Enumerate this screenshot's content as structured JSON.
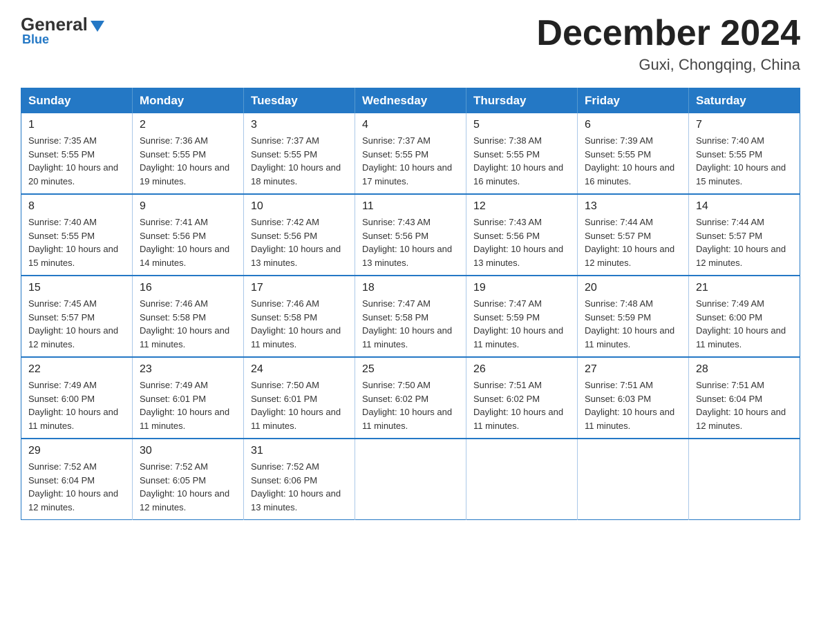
{
  "header": {
    "logo_general": "General",
    "logo_blue": "Blue",
    "month_title": "December 2024",
    "location": "Guxi, Chongqing, China"
  },
  "weekdays": [
    "Sunday",
    "Monday",
    "Tuesday",
    "Wednesday",
    "Thursday",
    "Friday",
    "Saturday"
  ],
  "weeks": [
    [
      {
        "day": "1",
        "sunrise": "7:35 AM",
        "sunset": "5:55 PM",
        "daylight": "10 hours and 20 minutes."
      },
      {
        "day": "2",
        "sunrise": "7:36 AM",
        "sunset": "5:55 PM",
        "daylight": "10 hours and 19 minutes."
      },
      {
        "day": "3",
        "sunrise": "7:37 AM",
        "sunset": "5:55 PM",
        "daylight": "10 hours and 18 minutes."
      },
      {
        "day": "4",
        "sunrise": "7:37 AM",
        "sunset": "5:55 PM",
        "daylight": "10 hours and 17 minutes."
      },
      {
        "day": "5",
        "sunrise": "7:38 AM",
        "sunset": "5:55 PM",
        "daylight": "10 hours and 16 minutes."
      },
      {
        "day": "6",
        "sunrise": "7:39 AM",
        "sunset": "5:55 PM",
        "daylight": "10 hours and 16 minutes."
      },
      {
        "day": "7",
        "sunrise": "7:40 AM",
        "sunset": "5:55 PM",
        "daylight": "10 hours and 15 minutes."
      }
    ],
    [
      {
        "day": "8",
        "sunrise": "7:40 AM",
        "sunset": "5:55 PM",
        "daylight": "10 hours and 15 minutes."
      },
      {
        "day": "9",
        "sunrise": "7:41 AM",
        "sunset": "5:56 PM",
        "daylight": "10 hours and 14 minutes."
      },
      {
        "day": "10",
        "sunrise": "7:42 AM",
        "sunset": "5:56 PM",
        "daylight": "10 hours and 13 minutes."
      },
      {
        "day": "11",
        "sunrise": "7:43 AM",
        "sunset": "5:56 PM",
        "daylight": "10 hours and 13 minutes."
      },
      {
        "day": "12",
        "sunrise": "7:43 AM",
        "sunset": "5:56 PM",
        "daylight": "10 hours and 13 minutes."
      },
      {
        "day": "13",
        "sunrise": "7:44 AM",
        "sunset": "5:57 PM",
        "daylight": "10 hours and 12 minutes."
      },
      {
        "day": "14",
        "sunrise": "7:44 AM",
        "sunset": "5:57 PM",
        "daylight": "10 hours and 12 minutes."
      }
    ],
    [
      {
        "day": "15",
        "sunrise": "7:45 AM",
        "sunset": "5:57 PM",
        "daylight": "10 hours and 12 minutes."
      },
      {
        "day": "16",
        "sunrise": "7:46 AM",
        "sunset": "5:58 PM",
        "daylight": "10 hours and 11 minutes."
      },
      {
        "day": "17",
        "sunrise": "7:46 AM",
        "sunset": "5:58 PM",
        "daylight": "10 hours and 11 minutes."
      },
      {
        "day": "18",
        "sunrise": "7:47 AM",
        "sunset": "5:58 PM",
        "daylight": "10 hours and 11 minutes."
      },
      {
        "day": "19",
        "sunrise": "7:47 AM",
        "sunset": "5:59 PM",
        "daylight": "10 hours and 11 minutes."
      },
      {
        "day": "20",
        "sunrise": "7:48 AM",
        "sunset": "5:59 PM",
        "daylight": "10 hours and 11 minutes."
      },
      {
        "day": "21",
        "sunrise": "7:49 AM",
        "sunset": "6:00 PM",
        "daylight": "10 hours and 11 minutes."
      }
    ],
    [
      {
        "day": "22",
        "sunrise": "7:49 AM",
        "sunset": "6:00 PM",
        "daylight": "10 hours and 11 minutes."
      },
      {
        "day": "23",
        "sunrise": "7:49 AM",
        "sunset": "6:01 PM",
        "daylight": "10 hours and 11 minutes."
      },
      {
        "day": "24",
        "sunrise": "7:50 AM",
        "sunset": "6:01 PM",
        "daylight": "10 hours and 11 minutes."
      },
      {
        "day": "25",
        "sunrise": "7:50 AM",
        "sunset": "6:02 PM",
        "daylight": "10 hours and 11 minutes."
      },
      {
        "day": "26",
        "sunrise": "7:51 AM",
        "sunset": "6:02 PM",
        "daylight": "10 hours and 11 minutes."
      },
      {
        "day": "27",
        "sunrise": "7:51 AM",
        "sunset": "6:03 PM",
        "daylight": "10 hours and 11 minutes."
      },
      {
        "day": "28",
        "sunrise": "7:51 AM",
        "sunset": "6:04 PM",
        "daylight": "10 hours and 12 minutes."
      }
    ],
    [
      {
        "day": "29",
        "sunrise": "7:52 AM",
        "sunset": "6:04 PM",
        "daylight": "10 hours and 12 minutes."
      },
      {
        "day": "30",
        "sunrise": "7:52 AM",
        "sunset": "6:05 PM",
        "daylight": "10 hours and 12 minutes."
      },
      {
        "day": "31",
        "sunrise": "7:52 AM",
        "sunset": "6:06 PM",
        "daylight": "10 hours and 13 minutes."
      },
      null,
      null,
      null,
      null
    ]
  ]
}
